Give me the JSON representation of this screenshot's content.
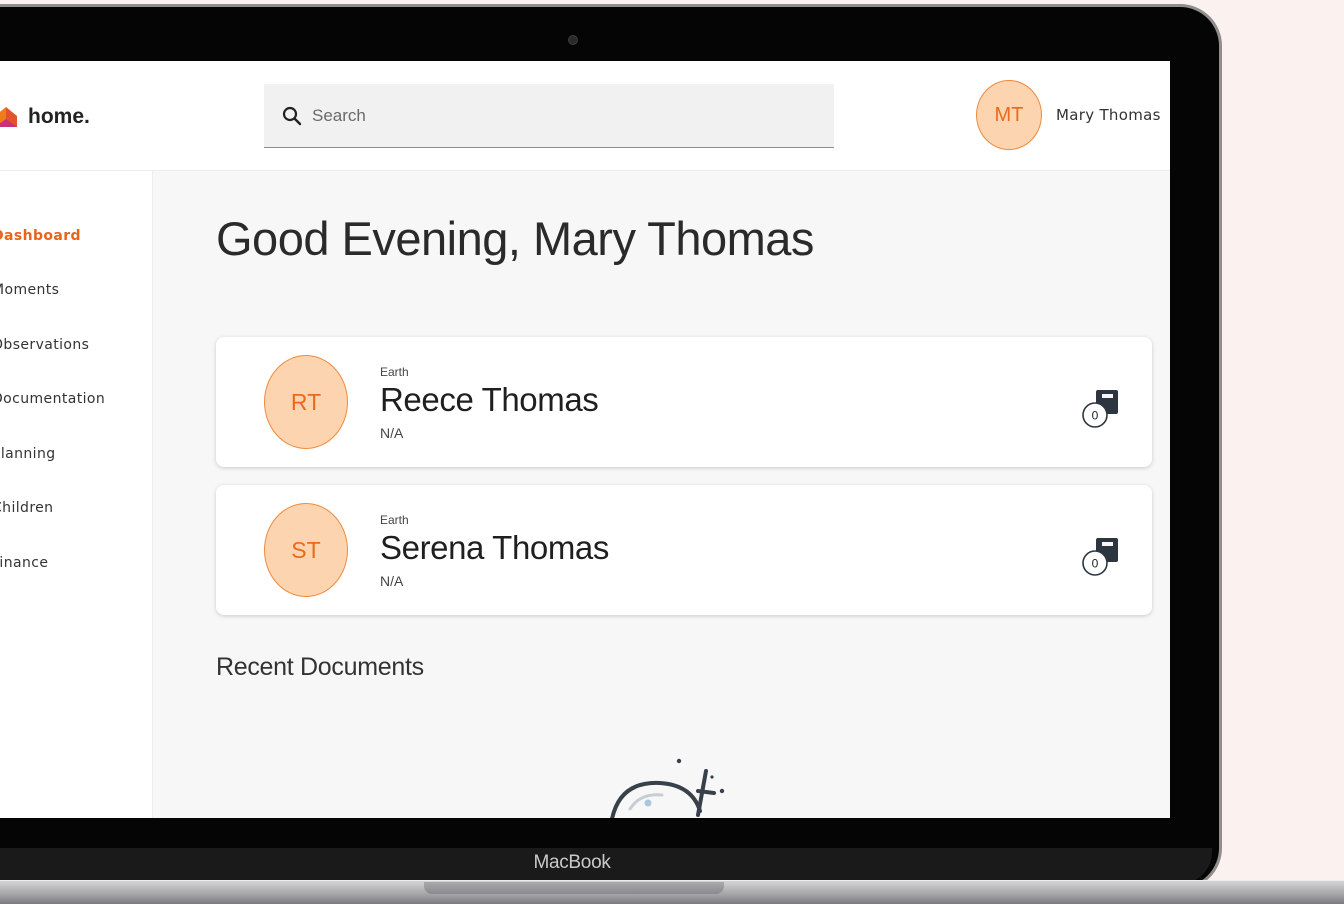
{
  "app": {
    "logo_text": "home.",
    "brand_colors": {
      "accent": "#e8641b",
      "avatar_bg": "#fcd5b0",
      "avatar_border": "#ef8a3c"
    }
  },
  "device": {
    "label": "MacBook"
  },
  "header": {
    "search_placeholder": "Search",
    "user": {
      "initials": "MT",
      "name": "Mary Thomas"
    }
  },
  "sidebar": {
    "items": [
      {
        "label": "Dashboard",
        "active": true
      },
      {
        "label": "Moments"
      },
      {
        "label": "Observations"
      },
      {
        "label": "Documentation"
      },
      {
        "label": "Planning"
      },
      {
        "label": "Children"
      },
      {
        "label": "Finance"
      }
    ]
  },
  "main": {
    "greeting": "Good Evening, Mary Thomas",
    "children": [
      {
        "initials": "RT",
        "planet": "Earth",
        "name": "Reece Thomas",
        "status": "N/A",
        "doc_count": "0"
      },
      {
        "initials": "ST",
        "planet": "Earth",
        "name": "Serena Thomas",
        "status": "N/A",
        "doc_count": "0"
      }
    ],
    "recent_documents_title": "Recent Documents"
  }
}
